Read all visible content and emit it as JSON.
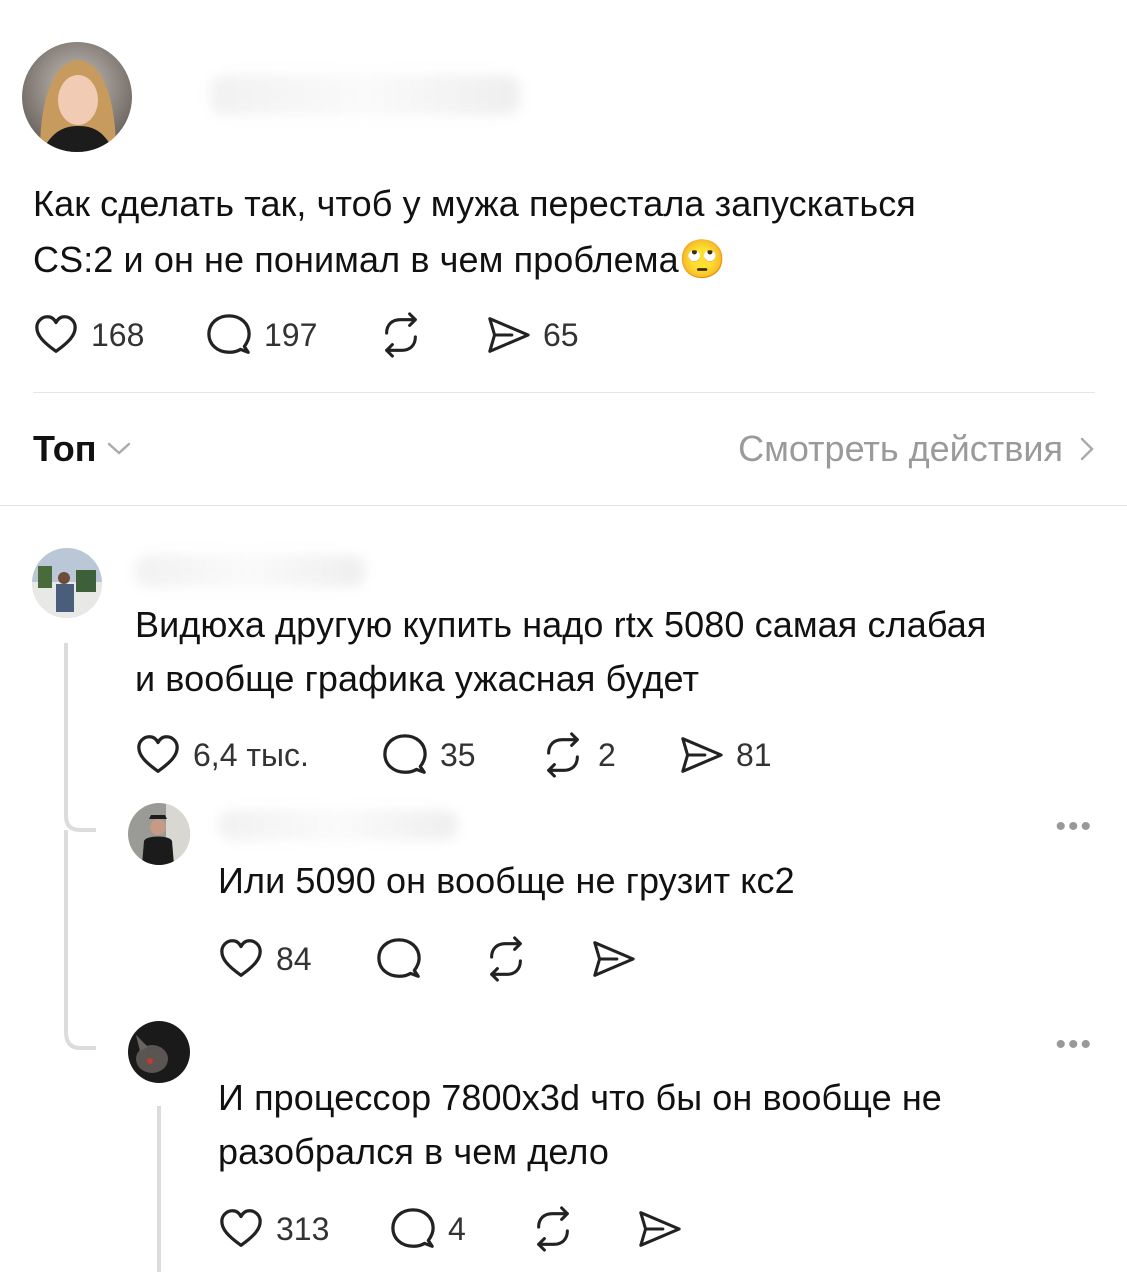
{
  "post": {
    "text_line1": "Как сделать так, чтоб у мужа перестала запускаться",
    "text_line2": "CS:2 и он не понимал в чем проблема",
    "emoji": "🙄",
    "likes": "168",
    "comments": "197",
    "shares": "65"
  },
  "filter": {
    "sort_label": "Топ",
    "activity_link": "Смотреть действия"
  },
  "comments": [
    {
      "text_line1": "Видюха другую купить надо rtx 5080 самая слабая",
      "text_line2": "и вообще графика ужасная будет",
      "likes": "6,4 тыс.",
      "replies": "35",
      "reposts": "2",
      "shares": "81"
    },
    {
      "text_line1": "Или 5090 он вообще не грузит кс2",
      "likes": "84",
      "more": "•••"
    },
    {
      "text_line1": "И процессор 7800x3d что бы он вообще не",
      "text_line2": "разобрался в чем дело",
      "likes": "313",
      "replies": "4",
      "more": "•••"
    }
  ],
  "icons": {
    "heart": "heart-icon",
    "comment": "comment-bubble-icon",
    "repost": "repost-icon",
    "share": "send-icon",
    "chevron_down": "chevron-down-icon",
    "chevron_right": "chevron-right-icon"
  }
}
